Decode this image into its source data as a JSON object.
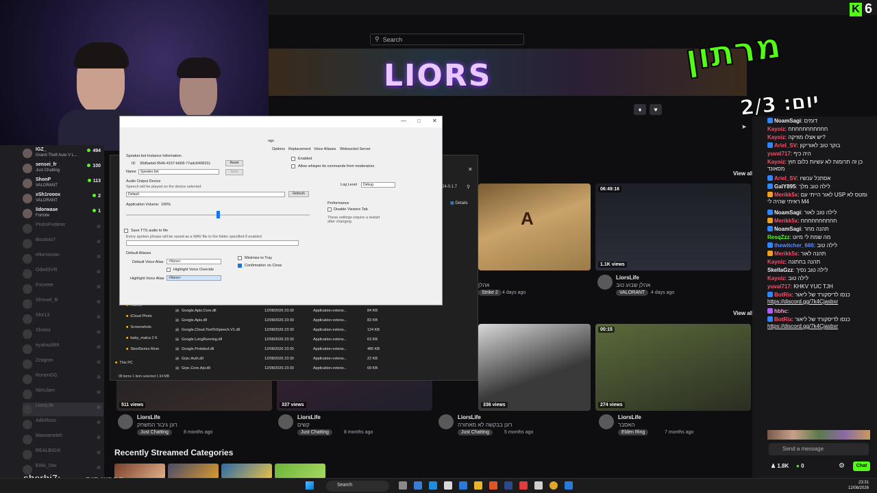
{
  "header": {
    "search_placeholder": "Search",
    "banner_title": "LIORS",
    "logo_letter": "K",
    "logo_number": "6"
  },
  "marathon": {
    "word": "מרתון",
    "day_label": "יום: 2/3"
  },
  "sidebar": {
    "channels": [
      {
        "name": "IGZ_",
        "sub": "Grand Theft Auto V L...",
        "viewers": "494",
        "online": true
      },
      {
        "name": "sensei_fr",
        "sub": "Just Chatting",
        "viewers": "100",
        "online": true
      },
      {
        "name": "ShonP",
        "sub": "VALORANT",
        "viewers": "113",
        "online": true
      },
      {
        "name": "xSh1rooox",
        "sub": "VALORANT",
        "viewers": "2",
        "online": true
      },
      {
        "name": "lidorwase",
        "sub": "Fortnite",
        "viewers": "1",
        "online": true
      },
      {
        "name": "PedroFederer",
        "online": false
      },
      {
        "name": "Boutinio7",
        "online": false
      },
      {
        "name": "ellorroorian",
        "online": false
      },
      {
        "name": "OdedSVR",
        "online": false
      },
      {
        "name": "Forceee",
        "online": false
      },
      {
        "name": "Shmuel_B",
        "online": false
      },
      {
        "name": "Shir13",
        "online": false
      },
      {
        "name": "Shotist",
        "online": false
      },
      {
        "name": "eyalraz899",
        "online": false
      },
      {
        "name": "Zzagron",
        "online": false
      },
      {
        "name": "RonenGG",
        "online": false
      },
      {
        "name": "NitroJam",
        "online": false
      },
      {
        "name": "LiorsLife",
        "online": false,
        "active": true
      },
      {
        "name": "AdinRoss",
        "online": false
      },
      {
        "name": "Maorameleh",
        "online": false
      },
      {
        "name": "REALBIGIII",
        "online": false
      },
      {
        "name": "Eitiki_Stw",
        "online": false
      }
    ]
  },
  "videos": {
    "view_all": "View all",
    "row1": [
      {
        "badge": "06:49:16",
        "views": "1.1K views",
        "channel": "LiorsLife",
        "title": "אהלן שבוע טוב",
        "tag": "VALORANT",
        "ago": "4 days ago"
      },
      {
        "tag": "Strike 2",
        "ago": "4 days ago",
        "title": "אהלן"
      }
    ],
    "row2": [
      {
        "views": "511 views",
        "channel": "LiorsLife",
        "title": "רונן גיבור המשחק",
        "tag": "Just Chatting",
        "ago": "8 months ago"
      },
      {
        "views": "337 views",
        "channel": "LiorsLife",
        "title": "קשים",
        "tag": "Just Chatting",
        "ago": "8 months ago"
      },
      {
        "views": "336 views",
        "channel": "LiorsLife",
        "title": "רונן בבקשה לא מאחורה",
        "tag": "Just Chatting",
        "ago": "5 months ago"
      },
      {
        "badge": "00:15",
        "views": "274 views",
        "channel": "LiorsLife",
        "title": "האסבר",
        "tag": "Elden Ring",
        "ago": "7 months ago"
      }
    ],
    "categories_title": "Recently Streamed Categories",
    "details": "Details"
  },
  "dialog": {
    "tabs": [
      "Options",
      "Replacement",
      "Voice Aliases",
      "Websocket Server"
    ],
    "tab_frag": "ngs",
    "instance_label": "Speaker.bot Instance Information",
    "id_label": "ID",
    "id_value": "30dfaebd-9546-4157-b668-77adc6408151",
    "reset": "Reset",
    "name_label": "Name",
    "name_value": "Speaker.bot",
    "save": "Save",
    "audio_label": "Audio Output Device",
    "audio_hint": "Speech will be played on the device selected",
    "audio_value": "Default",
    "refresh": "Refresh",
    "volume_label": "Application Volume:",
    "volume_value": "100%",
    "volume_fraction": 0.5,
    "enabled": "Enabled",
    "allow_whisper": "Allow whisper tts commands from moderators",
    "log_label": "Log Level",
    "log_value": "Debug",
    "perf_label": "Performance",
    "disable_viewers": "Disable Viewers Tab",
    "restart_note": "These settings require a restart after changing",
    "save_tts": "Save TTS audio to file",
    "save_tts_hint": "Every spoken phrase will be saved as a WAV file to the folder specified if enabled",
    "defaults_label": "Default Aliases",
    "default_voice_label": "Default Voice Alias",
    "default_voice_value": "<None>",
    "highlight_override": "Highlight Voice Override",
    "highlight_label": "Highlight Voice Alias",
    "highlight_value": "<None>",
    "minimize": "Minimize to Tray",
    "confirm": "Confirmation on Close"
  },
  "explorer": {
    "path_frag": "54-0.1.7",
    "folders": [
      "Videos",
      "iCloud Photo",
      "Screenshots",
      "baby_malca 2 K",
      "SteelSeries Mom",
      "This PC"
    ],
    "files": [
      {
        "name": "Google.Apis.Core.dll",
        "date": "12/08/2026 23:30",
        "type": "Application extens...",
        "size": "84 KB"
      },
      {
        "name": "Google.Apis.dll",
        "date": "12/08/2026 23:30",
        "type": "Application extens...",
        "size": "83 KB"
      },
      {
        "name": "Google.Cloud.TextToSpeech.V1.dll",
        "date": "12/08/2026 23:30",
        "type": "Application extens...",
        "size": "124 KB"
      },
      {
        "name": "Google.LongRunning.dll",
        "date": "12/08/2026 23:30",
        "type": "Application extens...",
        "size": "63 KB"
      },
      {
        "name": "Google.Protobuf.dll",
        "date": "12/08/2026 23:30",
        "type": "Application extens...",
        "size": "485 KB"
      },
      {
        "name": "Grpc.Auth.dll",
        "date": "12/08/2026 23:30",
        "type": "Application extens...",
        "size": "22 KB"
      },
      {
        "name": "Grpc.Core.Api.dll",
        "date": "12/08/2026 23:30",
        "type": "Application extens...",
        "size": "69 KB"
      }
    ],
    "status": "98 items   1 item selected  1.94 MB"
  },
  "chat": {
    "messages": [
      {
        "user": "NoamSagi",
        "text": "דומים",
        "color": "#efeff1",
        "badge": "#2f86ff"
      },
      {
        "user": "Kayoiz",
        "text": "חחחחחחחחחחח",
        "color": "#ff4d6a"
      },
      {
        "user": "Kayoiz",
        "text": "יש אצלו מוזיקה?",
        "color": "#ff4d6a"
      },
      {
        "user": "Ariel_SV",
        "text": "בוקר טוב לאוריקון",
        "color": "#ff4d6a",
        "badge": "#2f86ff"
      },
      {
        "user": "yuval717",
        "text": "היה כיף",
        "color": "#ff4d6a"
      },
      {
        "user": "Kayoiz",
        "text": "כן זה תרומות לא עשיות כלום חוץ מסאונד",
        "color": "#ff4d6a"
      },
      {
        "user": "Ariel_SV",
        "text": "אסתכל עכשיו",
        "color": "#ff4d6a",
        "badge": "#2f86ff"
      },
      {
        "user": "GalY895",
        "text": "לילה טוב מלך",
        "color": "#efeff1",
        "badge": "#2f86ff"
      },
      {
        "user": "Merikk5x",
        "text": "לאור הייתי עם USP ומטס לא ראיתי שהיה לי M4",
        "color": "#ff4d6a",
        "badge": "#f0a020"
      },
      {
        "user": "NoamSagi",
        "text": "לילה טוב לאור",
        "color": "#efeff1",
        "badge": "#2f86ff"
      },
      {
        "user": "Merikk5x",
        "text": "חחחחחחחחחח",
        "color": "#ff4d6a",
        "badge": "#f0a020"
      },
      {
        "user": "NoamSagi",
        "text": "תהנה מחר",
        "color": "#efeff1",
        "badge": "#2f86ff"
      },
      {
        "user": "ResqZzz",
        "text": "מה שמת לי מיוט",
        "color": "#53fc18"
      },
      {
        "user": "thewitcher_666",
        "text": "לילה טוב",
        "color": "#5b8cff",
        "badge": "#2f86ff"
      },
      {
        "user": "Merikk5x",
        "text": "תהנה לאור",
        "color": "#ff4d6a",
        "badge": "#f0a020"
      },
      {
        "user": "Kayoiz",
        "text": "תהנה בחתונה",
        "color": "#ff4d6a"
      },
      {
        "user": "SkellaGzz",
        "text": "לילה טוב נסיך",
        "color": "#efeff1"
      },
      {
        "user": "Kayoiz",
        "text": "לילה טוב",
        "color": "#ff4d6a"
      },
      {
        "user": "yuval717",
        "text": "KHKV YUC TJH",
        "color": "#ff4d6a"
      },
      {
        "user": "BotRix",
        "text": "כנסו לדיסקורד של ליאור",
        "link": "https://discord.gg/7k4Cjasbxr",
        "color": "#ff4d6a",
        "badge": "#2f86ff"
      },
      {
        "user": "hbhc",
        "text": "",
        "color": "#ff9ad5",
        "badge": "#b05cff"
      },
      {
        "user": "BotRix",
        "text": "כנסו לדיסקורד של ליאור",
        "link": "https://discord.gg/7k4Cjasbxr",
        "color": "#ff4d6a",
        "badge": "#2f86ff"
      }
    ],
    "input_placeholder": "Send a message",
    "followers": "1.8K",
    "points": "0",
    "chat_button": "Chat"
  },
  "overlay": {
    "username": "sherbi7:",
    "message": "תחפש קיק",
    "channel_sub": "מצגון חללגיח"
  },
  "taskbar": {
    "search": "Search",
    "time": "23:31",
    "date": "12/08/2026"
  }
}
